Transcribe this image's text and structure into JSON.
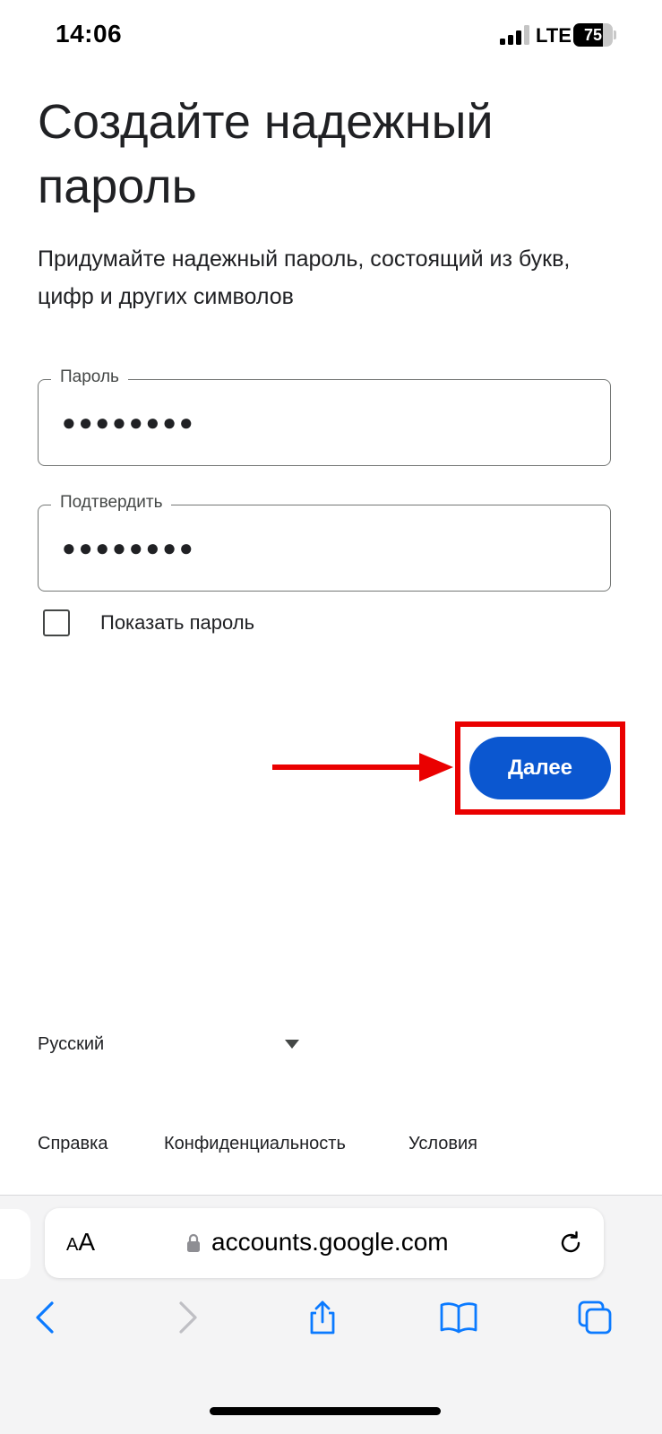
{
  "status_bar": {
    "time": "14:06",
    "network": "LTE",
    "battery_level": "75",
    "battery_fraction": 0.75
  },
  "page": {
    "title": "Создайте надежный пароль",
    "subtitle": "Придумайте надежный пароль, состоящий из букв, цифр и других символов"
  },
  "form": {
    "password": {
      "label": "Пароль",
      "value": "●●●●●●●●"
    },
    "confirm": {
      "label": "Подтвердить",
      "value": "●●●●●●●●"
    },
    "show_password": {
      "label": "Показать пароль",
      "checked": false
    },
    "next_label": "Далее"
  },
  "annotation": {
    "color": "#ea0000"
  },
  "footer": {
    "language": "Русский",
    "links": [
      "Справка",
      "Конфиденциальность",
      "Условия"
    ]
  },
  "browser": {
    "text_size_small": "A",
    "text_size_large": "A",
    "url": "accounts.google.com",
    "accent_color": "#0b7aff"
  },
  "colors": {
    "primary_button": "#0b57d0",
    "text": "#202124"
  }
}
